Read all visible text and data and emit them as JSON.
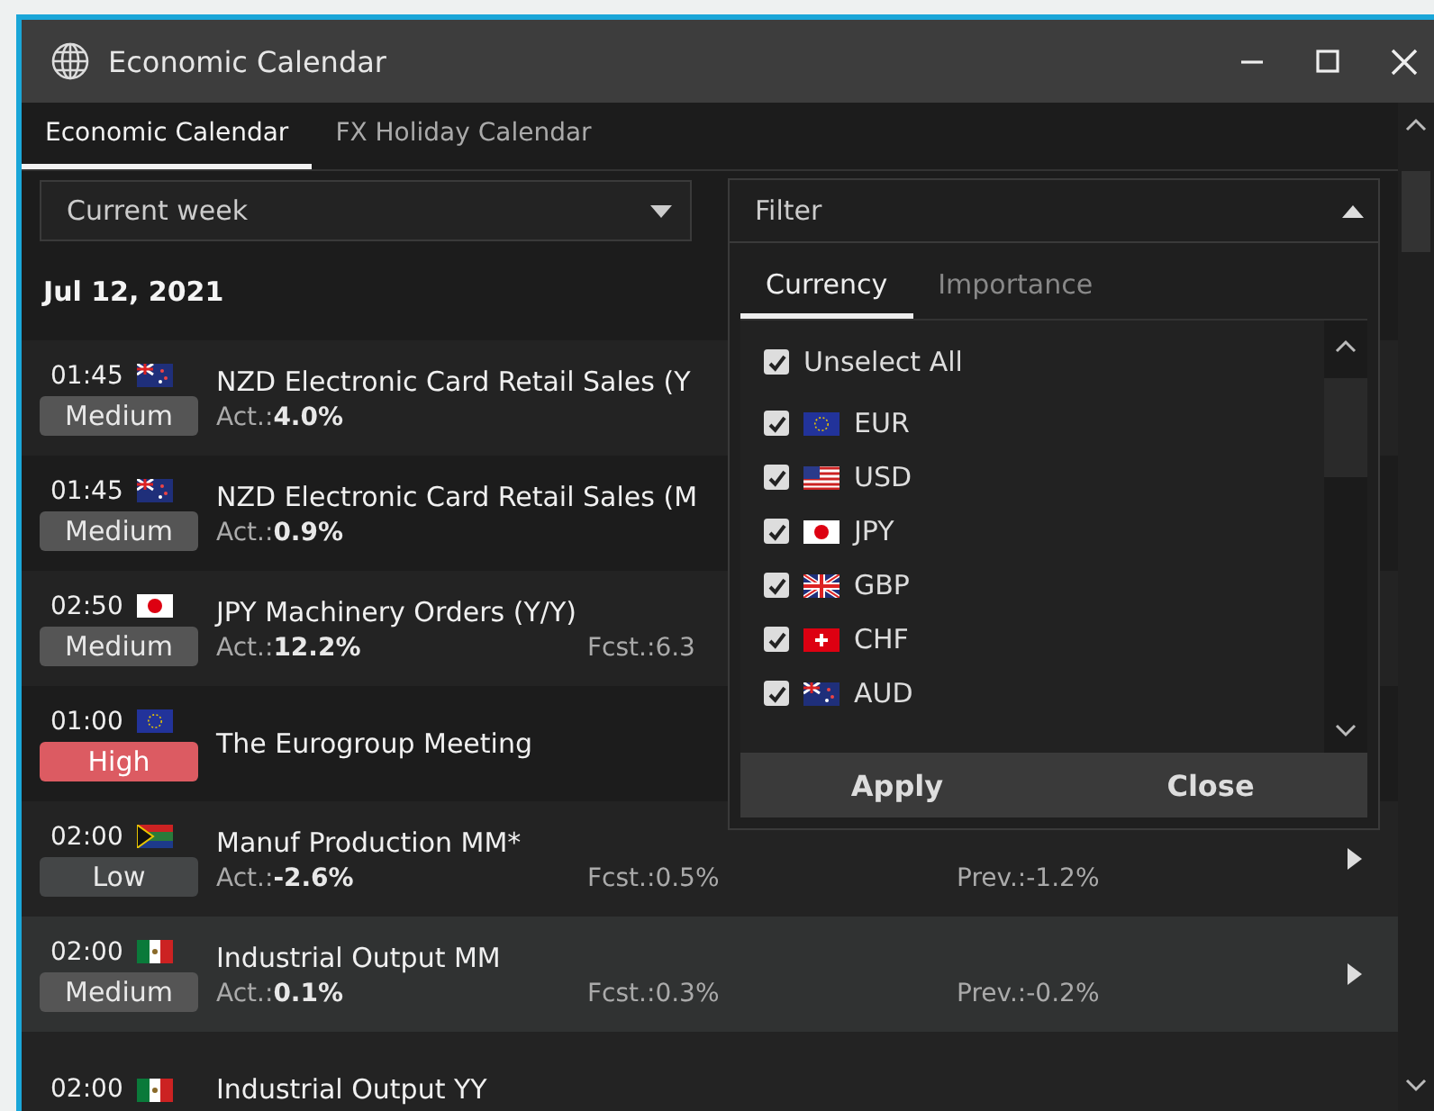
{
  "window": {
    "title": "Economic Calendar"
  },
  "tabs": [
    {
      "label": "Economic Calendar",
      "selected": true
    },
    {
      "label": "FX Holiday Calendar",
      "selected": false
    }
  ],
  "period_dropdown": {
    "value": "Current week"
  },
  "date_header": "Jul 12, 2021",
  "events": [
    {
      "time": "01:45",
      "kind": "nz",
      "importance": {
        "kind": "medium",
        "label": "Medium"
      },
      "title": "NZD Electronic Card Retail Sales (Y",
      "actual": "Act.:**4.0%**",
      "arrow": false,
      "selected": false
    },
    {
      "time": "01:45",
      "kind": "nz",
      "importance": {
        "kind": "medium",
        "label": "Medium"
      },
      "title": "NZD Electronic Card Retail Sales (M",
      "actual": "Act.:**0.9%**",
      "arrow": false,
      "selected": false
    },
    {
      "time": "02:50",
      "kind": "jp",
      "importance": {
        "kind": "medium",
        "label": "Medium"
      },
      "title": "JPY Machinery Orders (Y/Y)",
      "actual": "Act.:**12.2%**",
      "forecast": "Fcst.:6.3",
      "arrow": false,
      "selected": false
    },
    {
      "time": "01:00",
      "kind": "eu",
      "importance": {
        "kind": "high",
        "label": "High"
      },
      "title": "The Eurogroup Meeting",
      "arrow": false,
      "selected": false
    },
    {
      "time": "02:00",
      "kind": "za",
      "importance": {
        "kind": "low",
        "label": "Low"
      },
      "title": "Manuf Production MM*",
      "actual": "Act.:**-2.6%**",
      "forecast": "Fcst.:0.5%",
      "previous": "Prev.:-1.2%",
      "arrow": true,
      "selected": false
    },
    {
      "time": "02:00",
      "kind": "mx",
      "importance": {
        "kind": "medium",
        "label": "Medium"
      },
      "title": "Industrial Output MM",
      "actual": "Act.:**0.1%**",
      "forecast": "Fcst.:0.3%",
      "previous": "Prev.:-0.2%",
      "arrow": true,
      "selected": true
    },
    {
      "time": "02:00",
      "kind": "mx",
      "title": "Industrial Output YY",
      "arrow": false,
      "selected": false
    }
  ],
  "filter": {
    "label": "Filter",
    "expanded": true,
    "tabs": [
      {
        "label": "Currency",
        "selected": true
      },
      {
        "label": "Importance",
        "selected": false
      }
    ],
    "select_all": {
      "label": "Unselect All",
      "checked": true
    },
    "currencies": [
      {
        "kind": "eu",
        "label": "EUR",
        "checked": true
      },
      {
        "kind": "us",
        "label": "USD",
        "checked": true
      },
      {
        "kind": "jp",
        "label": "JPY",
        "checked": true
      },
      {
        "kind": "gb",
        "label": "GBP",
        "checked": true
      },
      {
        "kind": "ch",
        "label": "CHF",
        "checked": true
      },
      {
        "kind": "au",
        "label": "AUD",
        "checked": true
      }
    ],
    "buttons": [
      "Apply",
      "Close"
    ]
  }
}
